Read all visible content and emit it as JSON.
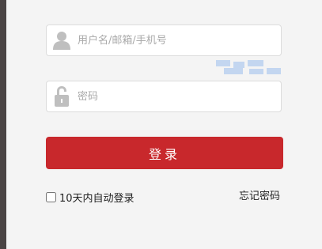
{
  "login": {
    "username_placeholder": "用户名/邮箱/手机号",
    "password_placeholder": "密码",
    "submit_label": "登录",
    "auto_login_label": "10天内自动登录",
    "auto_login_checked": false,
    "forgot_password_label": "忘记密码"
  },
  "colors": {
    "primary_button": "#c8282c",
    "background": "#f4f4f4"
  },
  "icons": {
    "username": "user-icon",
    "password": "lock-icon"
  }
}
